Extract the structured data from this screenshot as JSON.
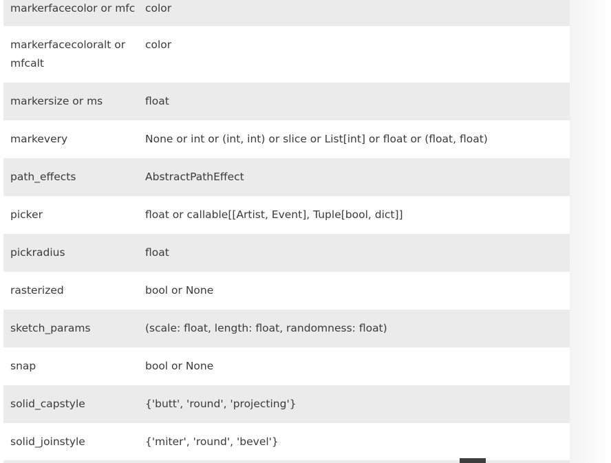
{
  "rows": [
    {
      "property": "markerfacecolor or mfc",
      "description": "color"
    },
    {
      "property": "markerfacecoloralt or mfcalt",
      "description": "color"
    },
    {
      "property": "markersize or ms",
      "description": "float"
    },
    {
      "property": "markevery",
      "description": "None or int or (int, int) or slice or List[int] or float or (float, float)"
    },
    {
      "property": "path_effects",
      "description": "AbstractPathEffect"
    },
    {
      "property": "picker",
      "description": "float or callable[[Artist, Event], Tuple[bool, dict]]"
    },
    {
      "property": "pickradius",
      "description": "float"
    },
    {
      "property": "rasterized",
      "description": "bool or None"
    },
    {
      "property": "sketch_params",
      "description": "(scale: float, length: float, randomness: float)"
    },
    {
      "property": "snap",
      "description": "bool or None"
    },
    {
      "property": "solid_capstyle",
      "description": "{'butt', 'round', 'projecting'}"
    },
    {
      "property": "solid_joinstyle",
      "description": "{'miter', 'round', 'bevel'}"
    }
  ]
}
